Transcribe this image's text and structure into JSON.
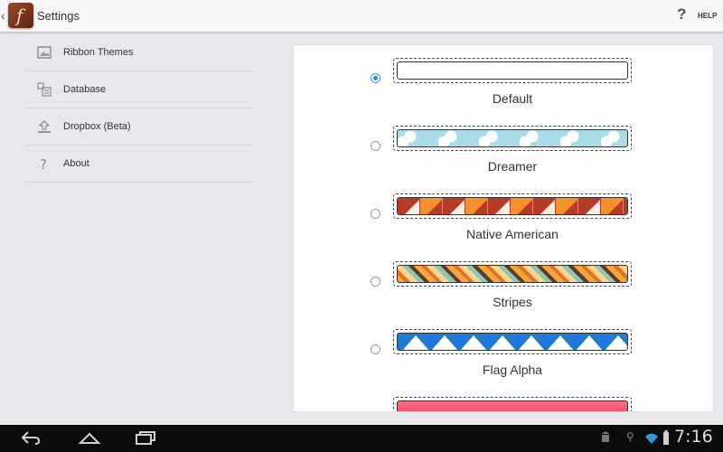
{
  "app": {
    "title": "Settings",
    "logo_letter": "f",
    "help_label": "HELP",
    "help_glyph": "?"
  },
  "sidebar": {
    "items": [
      {
        "label": "Ribbon Themes",
        "icon": "image-icon"
      },
      {
        "label": "Database",
        "icon": "database-icon"
      },
      {
        "label": "Dropbox (Beta)",
        "icon": "upload-icon"
      },
      {
        "label": "About",
        "icon": "question-icon"
      }
    ]
  },
  "themes": {
    "selected": "Default",
    "items": [
      {
        "name": "Default",
        "selected": true
      },
      {
        "name": "Dreamer",
        "selected": false
      },
      {
        "name": "Native American",
        "selected": false
      },
      {
        "name": "Stripes",
        "selected": false
      },
      {
        "name": "Flag Alpha",
        "selected": false
      },
      {
        "name": "",
        "selected": false
      }
    ]
  },
  "system_bar": {
    "time": "7:16"
  },
  "colors": {
    "accent": "#2b8ad0",
    "native_red": "#b63a26",
    "native_orange": "#f2922a",
    "flag_blue": "#1d7bd8",
    "pink": "#ff6a83"
  }
}
